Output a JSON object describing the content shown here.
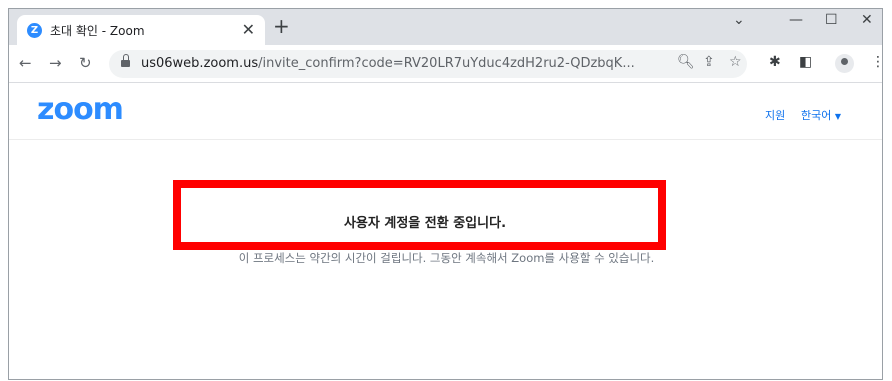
{
  "browser": {
    "tab_title": "초대 확인 - Zoom",
    "tab_favicon_letter": "Z",
    "url_host": "us06web.zoom.us",
    "url_path": "/invite_confirm?code=RV20LR7uYduc4zdH2ru2-QDzbqK..."
  },
  "page": {
    "logo": "zoom",
    "support_link": "지원",
    "language_link": "한국어",
    "status_message": "사용자 계정을 전환 중입니다.",
    "sub_message": "이 프로세스는 약간의 시간이 걸립니다. 그동안 계속해서 Zoom를 사용할 수 있습니다."
  },
  "colors": {
    "zoom_blue": "#2d8cff",
    "link_blue": "#0e72ed",
    "highlight_red": "#ff0000"
  }
}
